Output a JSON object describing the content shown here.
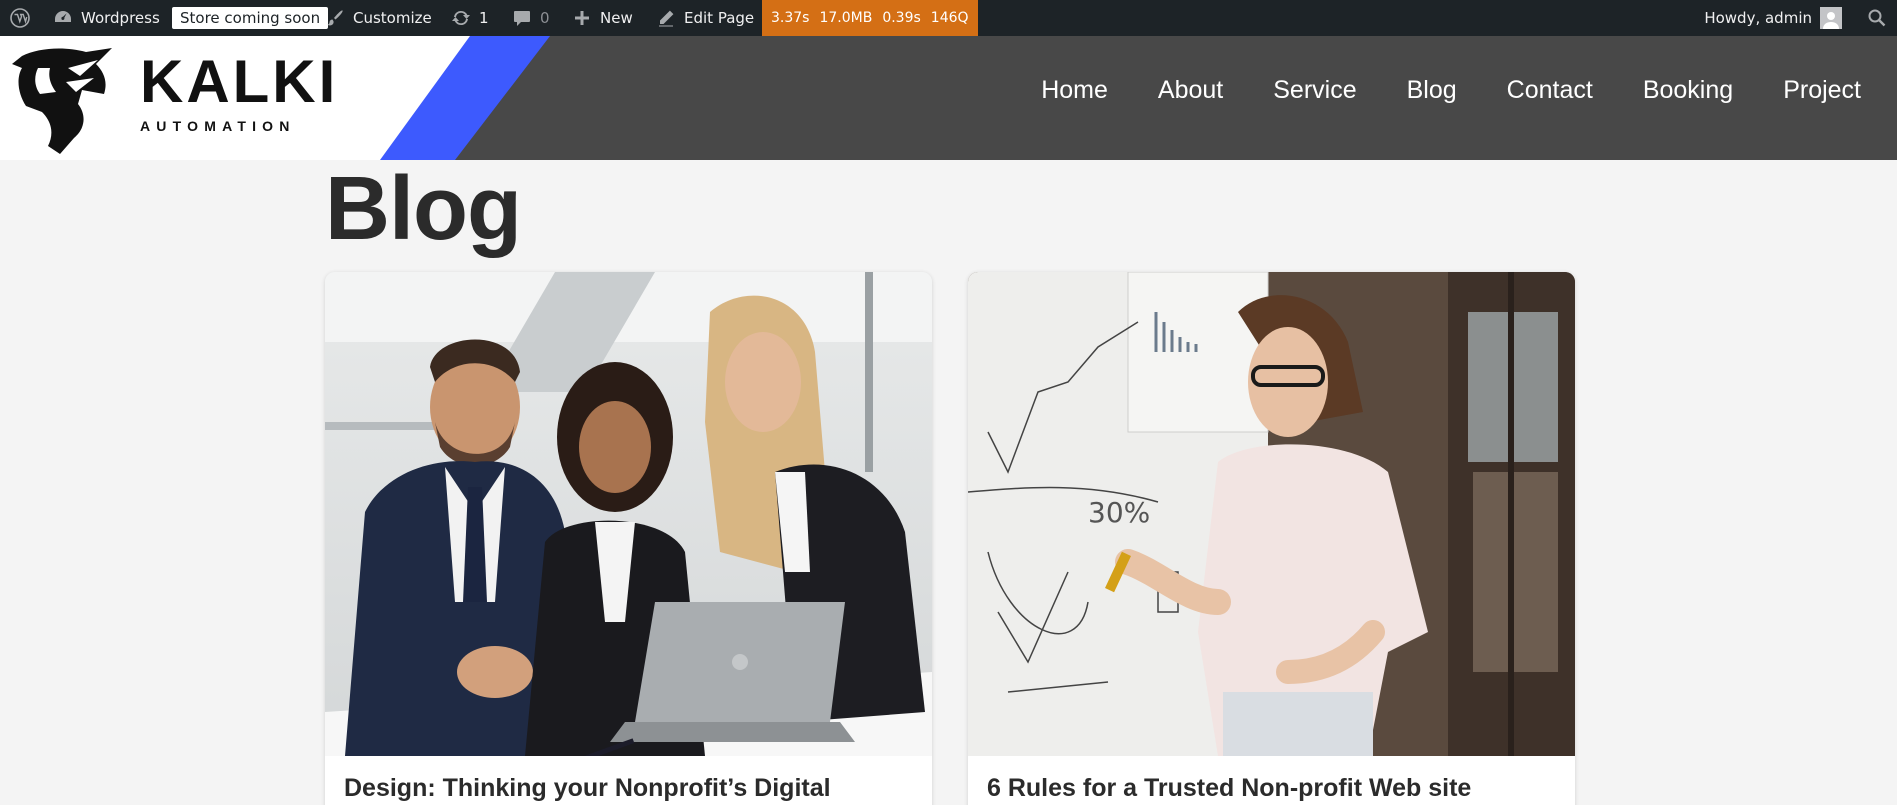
{
  "admin_bar": {
    "site_name": "Wordpress",
    "store_badge": "Store coming soon",
    "customize": "Customize",
    "updates_count": "1",
    "comments_count": "0",
    "new_label": "New",
    "edit_page": "Edit Page",
    "perf": {
      "time": "3.37s",
      "memory": "17.0MB",
      "query_time": "0.39s",
      "queries": "146Q"
    },
    "howdy": "Howdy, admin"
  },
  "header": {
    "logo_title": "KALKI",
    "logo_subtitle": "AUTOMATION",
    "nav": [
      "Home",
      "About",
      "Service",
      "Blog",
      "Contact",
      "Booking",
      "Project"
    ],
    "colors": {
      "accent": "#3d5afe",
      "header_bg": "#484848"
    }
  },
  "main": {
    "title": "Blog",
    "posts": [
      {
        "title": "Design: Thinking your Nonprofit’s Digital",
        "image": "business-team-laptop-photo"
      },
      {
        "title": "6 Rules for a Trusted Non-profit Web site",
        "image": "presenter-whiteboard-photo"
      }
    ]
  }
}
